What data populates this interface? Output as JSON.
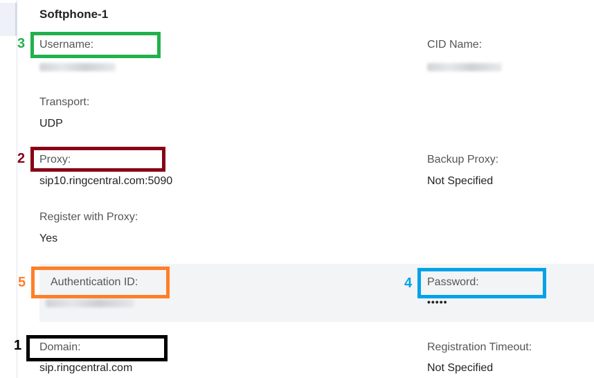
{
  "title": "Softphone-1",
  "fields": {
    "username": {
      "label": "Username:"
    },
    "cid_name": {
      "label": "CID Name:"
    },
    "transport": {
      "label": "Transport:",
      "value": "UDP"
    },
    "proxy": {
      "label": "Proxy:",
      "value": "sip10.ringcentral.com:5090"
    },
    "backup_proxy": {
      "label": "Backup Proxy:",
      "value": "Not Specified"
    },
    "register_with_proxy": {
      "label": "Register with Proxy:",
      "value": "Yes"
    },
    "authentication_id": {
      "label": "Authentication ID:"
    },
    "password": {
      "label": "Password:",
      "value": "•••••"
    },
    "domain": {
      "label": "Domain:",
      "value": "sip.ringcentral.com"
    },
    "registration_timeout": {
      "label": "Registration Timeout:",
      "value": "Not Specified"
    }
  },
  "annotations": {
    "username": {
      "number": "3",
      "color": "#22b14c"
    },
    "proxy": {
      "number": "2",
      "color": "#880015"
    },
    "authentication_id": {
      "number": "5",
      "color": "#ff7f27"
    },
    "password": {
      "number": "4",
      "color": "#00a2e8"
    },
    "domain": {
      "number": "1",
      "color": "#000000"
    }
  }
}
